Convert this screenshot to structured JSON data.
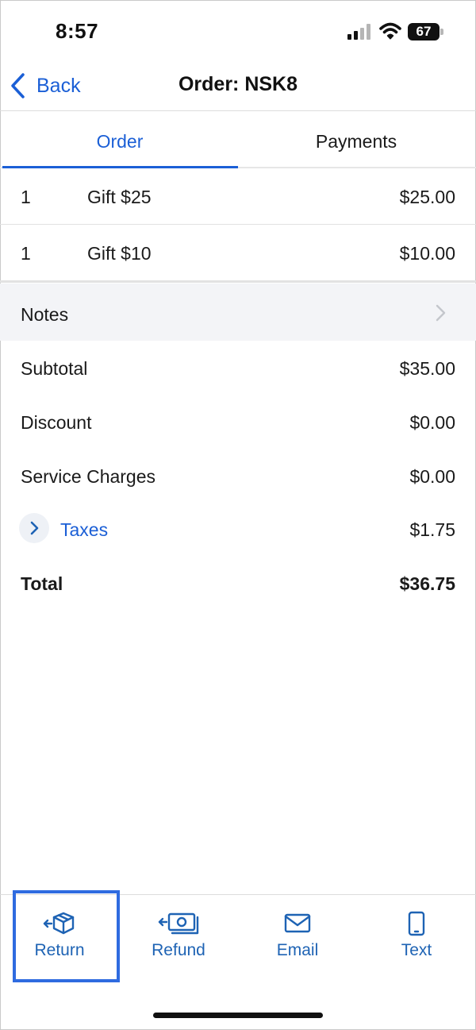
{
  "status_bar": {
    "time": "8:57",
    "battery": "67"
  },
  "nav": {
    "back_label": "Back",
    "title": "Order: NSK8"
  },
  "tabs": [
    {
      "label": "Order",
      "active": true
    },
    {
      "label": "Payments",
      "active": false
    }
  ],
  "items": [
    {
      "qty": "1",
      "name": "Gift $25",
      "price": "$25.00"
    },
    {
      "qty": "1",
      "name": "Gift $10",
      "price": "$10.00"
    }
  ],
  "notes": {
    "label": "Notes"
  },
  "summary": {
    "subtotal": {
      "label": "Subtotal",
      "value": "$35.00"
    },
    "discount": {
      "label": "Discount",
      "value": "$0.00"
    },
    "service_charges": {
      "label": "Service Charges",
      "value": "$0.00"
    },
    "taxes": {
      "label": "Taxes",
      "value": "$1.75"
    },
    "total": {
      "label": "Total",
      "value": "$36.75"
    }
  },
  "toolbar": {
    "return_label": "Return",
    "refund_label": "Refund",
    "email_label": "Email",
    "text_label": "Text"
  },
  "colors": {
    "accent": "#1b5fd6",
    "toolbar_text": "#1e63b4",
    "highlight": "#2f6be0",
    "notes_bg": "#f3f4f7"
  },
  "icons": {
    "back": "chevron-left-icon",
    "notes": "chevron-right-icon",
    "taxes": "chevron-right-icon",
    "return": "box-return-icon",
    "refund": "cash-refund-icon",
    "email": "envelope-icon",
    "text": "phone-icon"
  }
}
